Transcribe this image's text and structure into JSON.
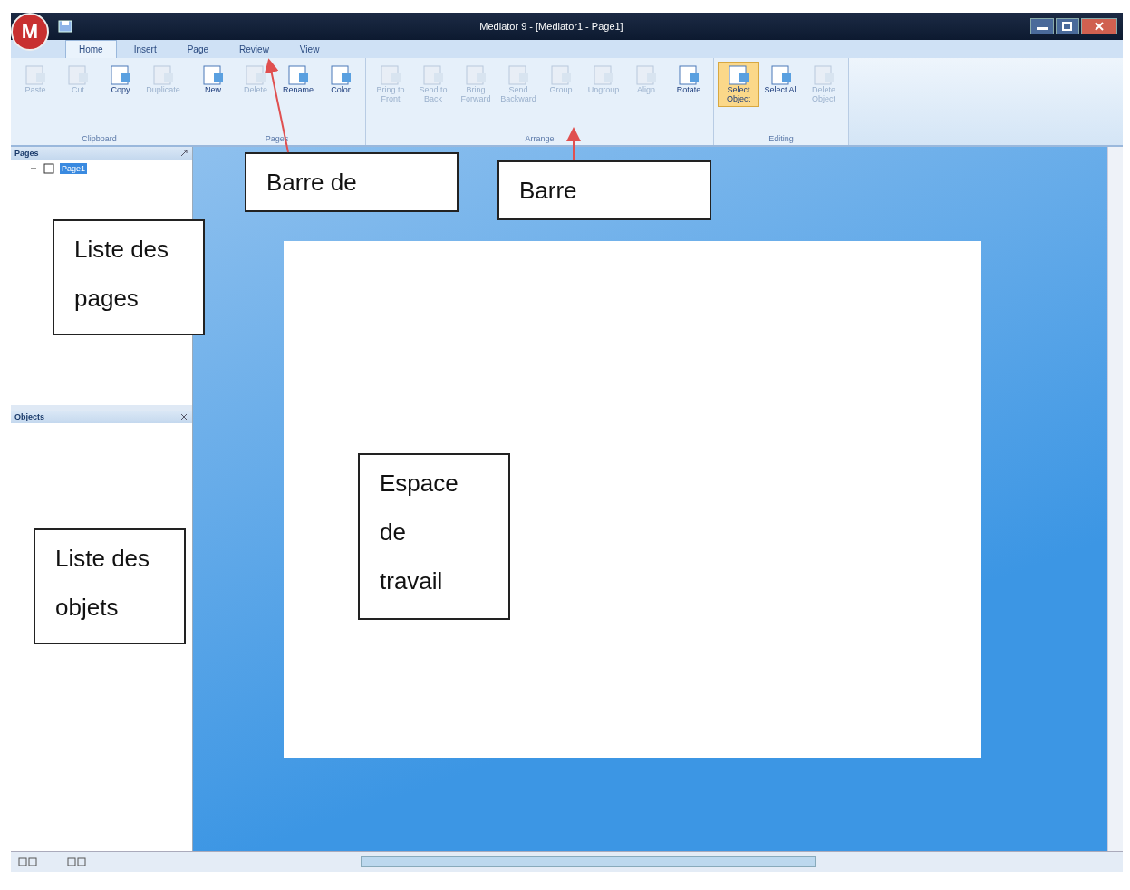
{
  "window": {
    "title": "Mediator 9 - [Mediator1 - Page1]",
    "logo": "M"
  },
  "tabs": [
    {
      "label": "Home",
      "selected": true
    },
    {
      "label": "Insert",
      "selected": false
    },
    {
      "label": "Page",
      "selected": false
    },
    {
      "label": "Review",
      "selected": false
    },
    {
      "label": "View",
      "selected": false
    }
  ],
  "ribbon_groups": [
    {
      "label": "Clipboard",
      "buttons": [
        {
          "label": "Paste",
          "disabled": true,
          "selected": false
        },
        {
          "label": "Cut",
          "disabled": true,
          "selected": false
        },
        {
          "label": "Copy",
          "disabled": false,
          "selected": false
        },
        {
          "label": "Duplicate",
          "disabled": true,
          "selected": false
        }
      ]
    },
    {
      "label": "Pages",
      "buttons": [
        {
          "label": "New",
          "disabled": false,
          "selected": false
        },
        {
          "label": "Delete",
          "disabled": true,
          "selected": false
        },
        {
          "label": "Rename",
          "disabled": false,
          "selected": false
        },
        {
          "label": "Color",
          "disabled": false,
          "selected": false
        }
      ]
    },
    {
      "label": "Arrange",
      "buttons": [
        {
          "label": "Bring to Front",
          "disabled": true,
          "selected": false
        },
        {
          "label": "Send to Back",
          "disabled": true,
          "selected": false
        },
        {
          "label": "Bring Forward",
          "disabled": true,
          "selected": false
        },
        {
          "label": "Send Backward",
          "disabled": true,
          "selected": false
        },
        {
          "label": "Group",
          "disabled": true,
          "selected": false
        },
        {
          "label": "Ungroup",
          "disabled": true,
          "selected": false
        },
        {
          "label": "Align",
          "disabled": true,
          "selected": false
        },
        {
          "label": "Rotate",
          "disabled": false,
          "selected": false
        }
      ]
    },
    {
      "label": "Editing",
      "buttons": [
        {
          "label": "Select Object",
          "disabled": false,
          "selected": true
        },
        {
          "label": "Select All",
          "disabled": false,
          "selected": false
        },
        {
          "label": "Delete Object",
          "disabled": true,
          "selected": false
        }
      ]
    }
  ],
  "pages_panel": {
    "title": "Pages",
    "items": [
      {
        "label": "Page1",
        "selected": true,
        "expanded": true
      }
    ]
  },
  "objects_panel": {
    "title": "Objects"
  },
  "callouts": [
    {
      "text": "Barre de"
    },
    {
      "text": "Barre"
    },
    {
      "text": "Liste des pages"
    },
    {
      "text": "Espace de travail"
    },
    {
      "text": "Liste des objets"
    }
  ]
}
